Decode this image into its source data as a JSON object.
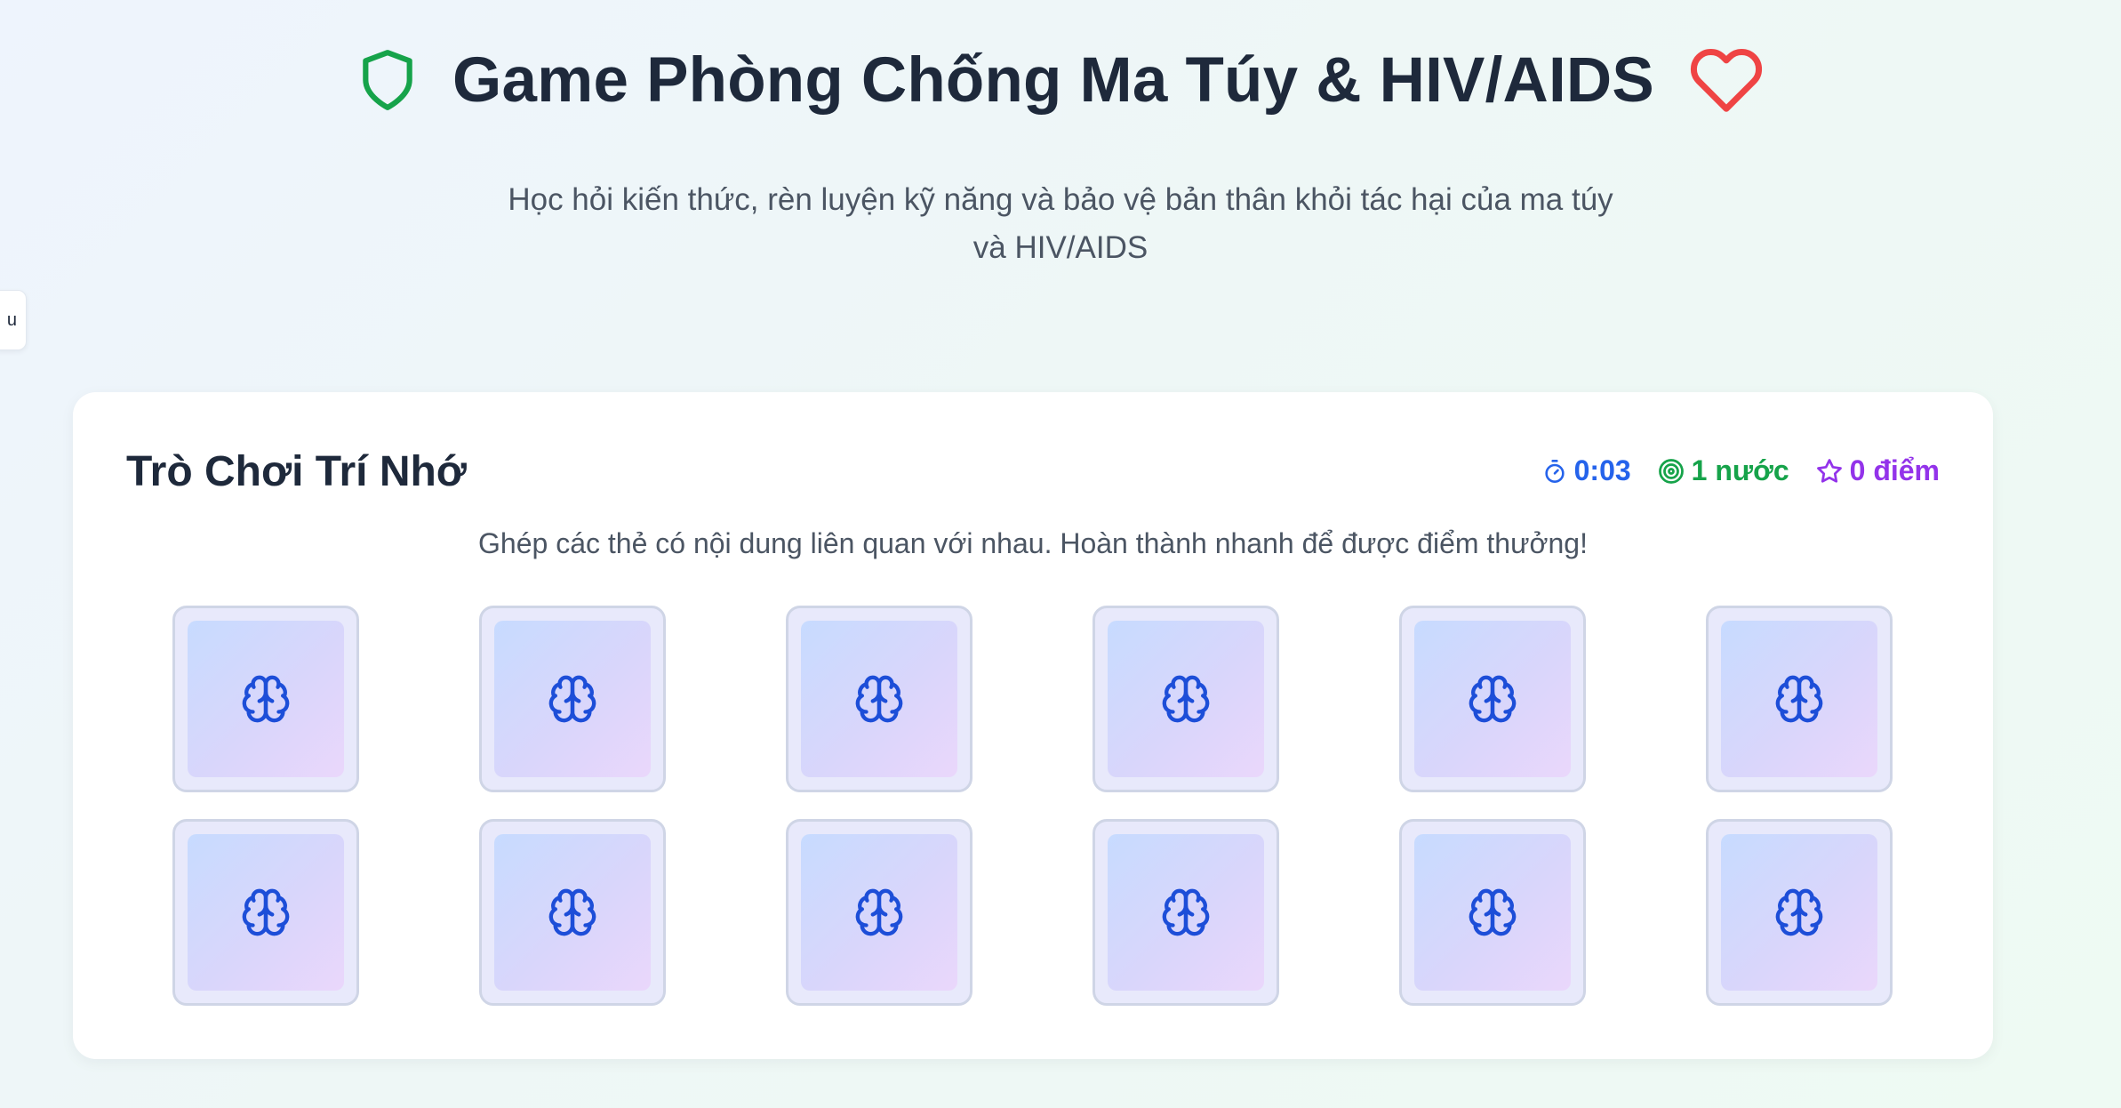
{
  "header": {
    "title": "Game Phòng Chống Ma Túy & HIV/AIDS",
    "subtitle": "Học hỏi kiến thức, rèn luyện kỹ năng và bảo vệ bản thân khỏi tác hại của ma túy và HIV/AIDS",
    "left_icon": "shield-icon",
    "right_icon": "heart-icon"
  },
  "side_tab": {
    "label": "u"
  },
  "game": {
    "title": "Trò Chơi Trí Nhớ",
    "instruction": "Ghép các thẻ có nội dung liên quan với nhau. Hoàn thành nhanh để được điểm thưởng!",
    "stats": {
      "time": "0:03",
      "moves": "1 nước",
      "score": "0 điểm"
    },
    "card_icon": "brain-icon",
    "card_count": 12
  },
  "colors": {
    "shield": "#16a34a",
    "heart": "#ef4444",
    "time": "#2563eb",
    "moves": "#16a34a",
    "score": "#9333ea",
    "brain": "#1d4ed8"
  }
}
